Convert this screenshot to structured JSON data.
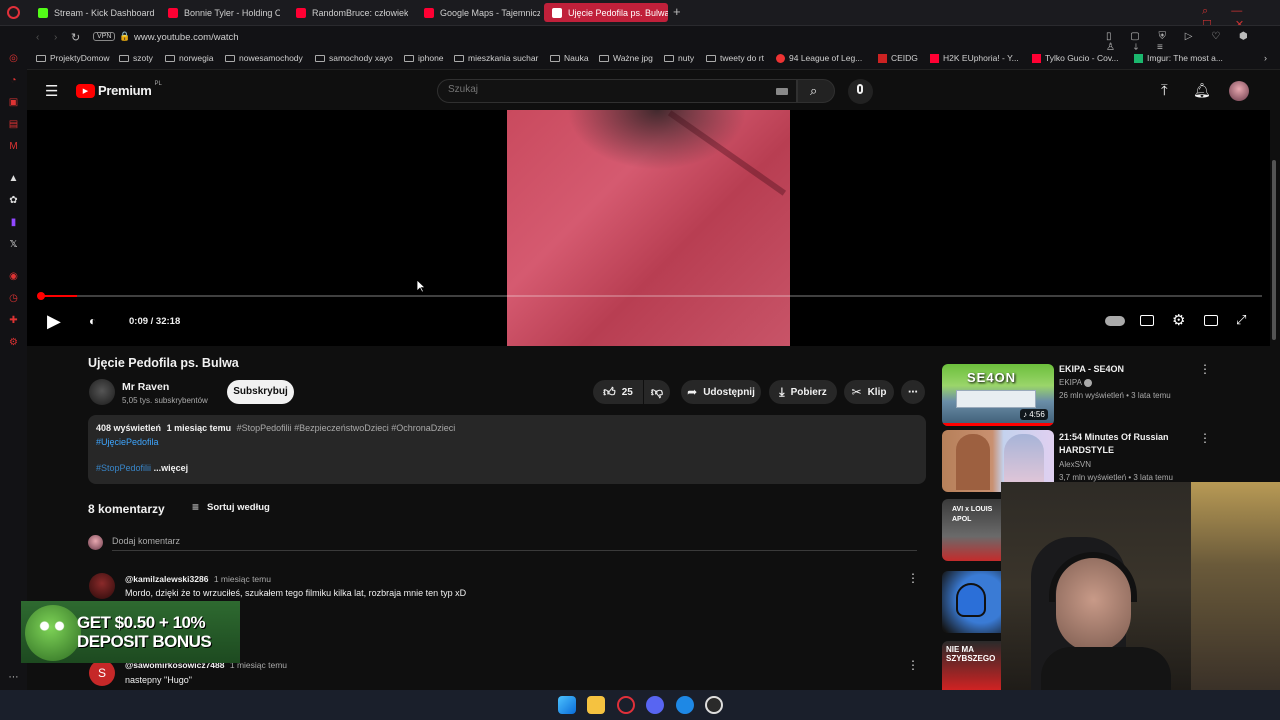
{
  "browser": {
    "tabs": [
      {
        "title": "Stream - Kick Dashboard",
        "color": "#53fc18"
      },
      {
        "title": "Bonnie Tyler - Holding O",
        "color": "#ff0033"
      },
      {
        "title": "RandomBruce: człowiek-",
        "color": "#ff0033"
      },
      {
        "title": "Google Maps - Tajemnicz",
        "color": "#ff0033"
      },
      {
        "title": "Ujęcie Pedofila ps. Bulwa",
        "color": "#ff0033"
      }
    ],
    "url": "www.youtube.com/watch",
    "vpn_label": "VPN",
    "bookmarks": [
      "ProjektyDomow",
      "szoty",
      "norwegia",
      "nowesamochody",
      "samochody xayo",
      "iphone",
      "mieszkania suchar",
      "Nauka",
      "Ważne jpg",
      "nuty",
      "tweety do rt",
      "94 League of Leg...",
      "CEIDG",
      "H2K EUphoria! - Y...",
      "Tylko Gucio - Cov...",
      "Imgur: The most a..."
    ]
  },
  "youtube": {
    "logo_text": "Premium",
    "logo_badge": "PL",
    "search_placeholder": "Szukaj",
    "player": {
      "time": "0:09 / 32:18",
      "progress": 0.0046
    },
    "video": {
      "title": "Ujęcie Pedofila ps. Bulwa",
      "channel": "Mr Raven",
      "subscribers": "5,05 tys. subskrybentów",
      "subscribe_label": "Subskrybuj",
      "likes": "25",
      "share_label": "Udostępnij",
      "download_label": "Pobierz",
      "clip_label": "Klip"
    },
    "description": {
      "views": "408 wyświetleń",
      "date": "1 miesiąc temu",
      "hashtags": "#StopPedofilii #BezpieczeństwoDzieci #OchronaDzieci",
      "hashtag2": "#UjęciePedofila",
      "hashtag3": "#StopPedofilii",
      "more": "...więcej"
    },
    "comments": {
      "count_label": "8 komentarzy",
      "sort_label": "Sortuj według",
      "add_placeholder": "Dodaj komentarz",
      "items": [
        {
          "author": "@kamilzalewski3286",
          "time": "1 miesiąc temu",
          "text": "Mordo, dzięki że to wrzuciłeś, szukałem tego filmiku kilka lat, rozbraja mnie ten typ xD"
        },
        {
          "author": "@sawomirkosowicz7488",
          "time": "1 miesiąc temu",
          "text": "nastepny \"Hugo\"",
          "avatar_letter": "S"
        }
      ]
    },
    "related": [
      {
        "title": "EKIPA - SE4ON",
        "channel": "EKIPA",
        "meta": "26 mln wyświetleń • 3 lata temu",
        "duration": "4:56",
        "thumb_text": "SE4ON"
      },
      {
        "title": "21:54 Minutes Of Russian HARDSTYLE",
        "channel": "AlexSVN",
        "meta": "3,7 mln wyświetleń • 3 lata temu"
      },
      {
        "thumb_text": "AVI x LOUIS APOL"
      },
      {
        "thumb_text": ""
      },
      {
        "thumb_text": "NIE MA SZYBSZEGO"
      }
    ]
  },
  "ad": {
    "line1": "GET $0.50 + 10%",
    "line2": "DEPOSIT BONUS"
  }
}
